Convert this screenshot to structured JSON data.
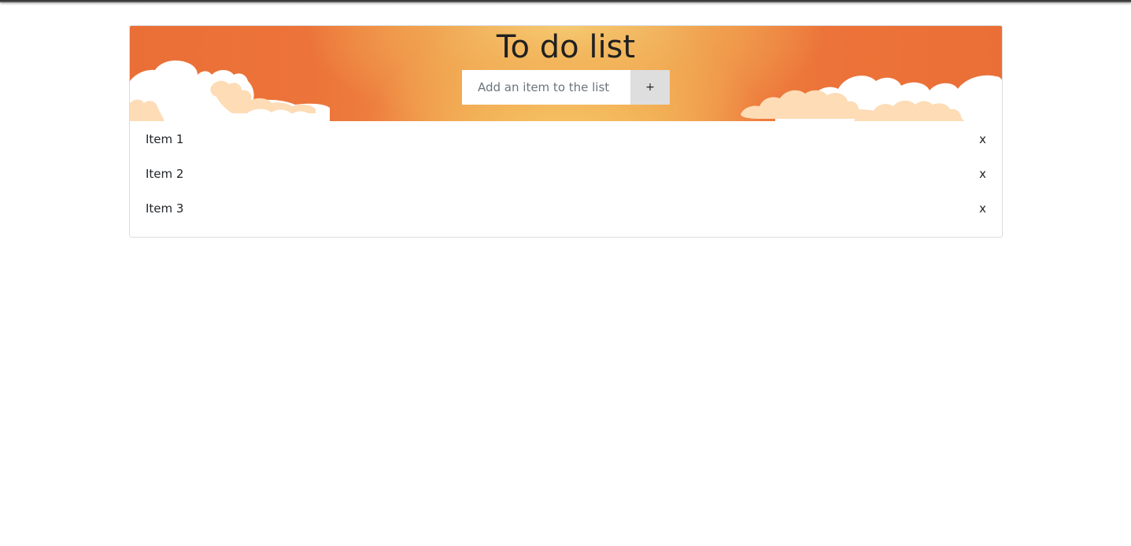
{
  "app": {
    "title": "To do list"
  },
  "add_form": {
    "placeholder": "Add an item to the list",
    "value": "",
    "add_label": "+"
  },
  "items": [
    {
      "label": "Item 1",
      "delete_label": "x"
    },
    {
      "label": "Item 2",
      "delete_label": "x"
    },
    {
      "label": "Item 3",
      "delete_label": "x"
    }
  ],
  "colors": {
    "header_orange": "#ea6f37",
    "header_glow": "#f5d27a",
    "cloud_white": "#ffffff",
    "cloud_peach": "#fddcb6",
    "add_button_bg": "#dedede"
  }
}
